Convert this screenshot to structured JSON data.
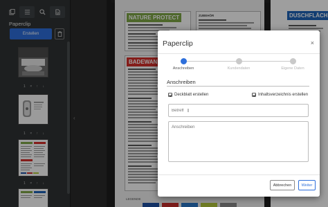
{
  "sidebar": {
    "tools": [
      {
        "icon": "pages-icon"
      },
      {
        "icon": "list-icon"
      },
      {
        "icon": "search-icon"
      },
      {
        "icon": "paperclip-doc-icon"
      }
    ],
    "title": "Paperclip",
    "create_button": "Erstellen",
    "thumb_controls": [
      "1",
      "×",
      "↑",
      "↓"
    ]
  },
  "document": {
    "box1_title": "NATURE PROTECT",
    "box2_title": "ZUBEHÖR",
    "box3_title": "DUSCHFLÄCH",
    "box4_title": "BADEWANN",
    "legend_label": "LEGENDE",
    "legend_colors": [
      "#1e4fa3",
      "#c9302c",
      "#2a78c9",
      "#b3c93a",
      "#8c8c8c"
    ]
  },
  "dialog": {
    "title": "Paperclip",
    "close_symbol": "×",
    "steps": [
      {
        "label": "Anschreiben",
        "active": true
      },
      {
        "label": "Kundendaten",
        "active": false
      },
      {
        "label": "Eigene Daten",
        "active": false
      }
    ],
    "section_title": "Anschreiben",
    "checkbox_cover": {
      "label": "Deckblatt erstellen",
      "checked": true
    },
    "checkbox_toc": {
      "label": "Inhaltsverzeichnis erstellen",
      "checked": true
    },
    "subject_placeholder": "Betreff",
    "body_placeholder": "Anschreiben",
    "cancel_button": "Abbrechen",
    "next_button": "Weiter"
  },
  "colors": {
    "accent": "#2e6fdb",
    "green_header": "#7ea646",
    "red_header": "#d6302a",
    "blue_header": "#1e63b8"
  }
}
